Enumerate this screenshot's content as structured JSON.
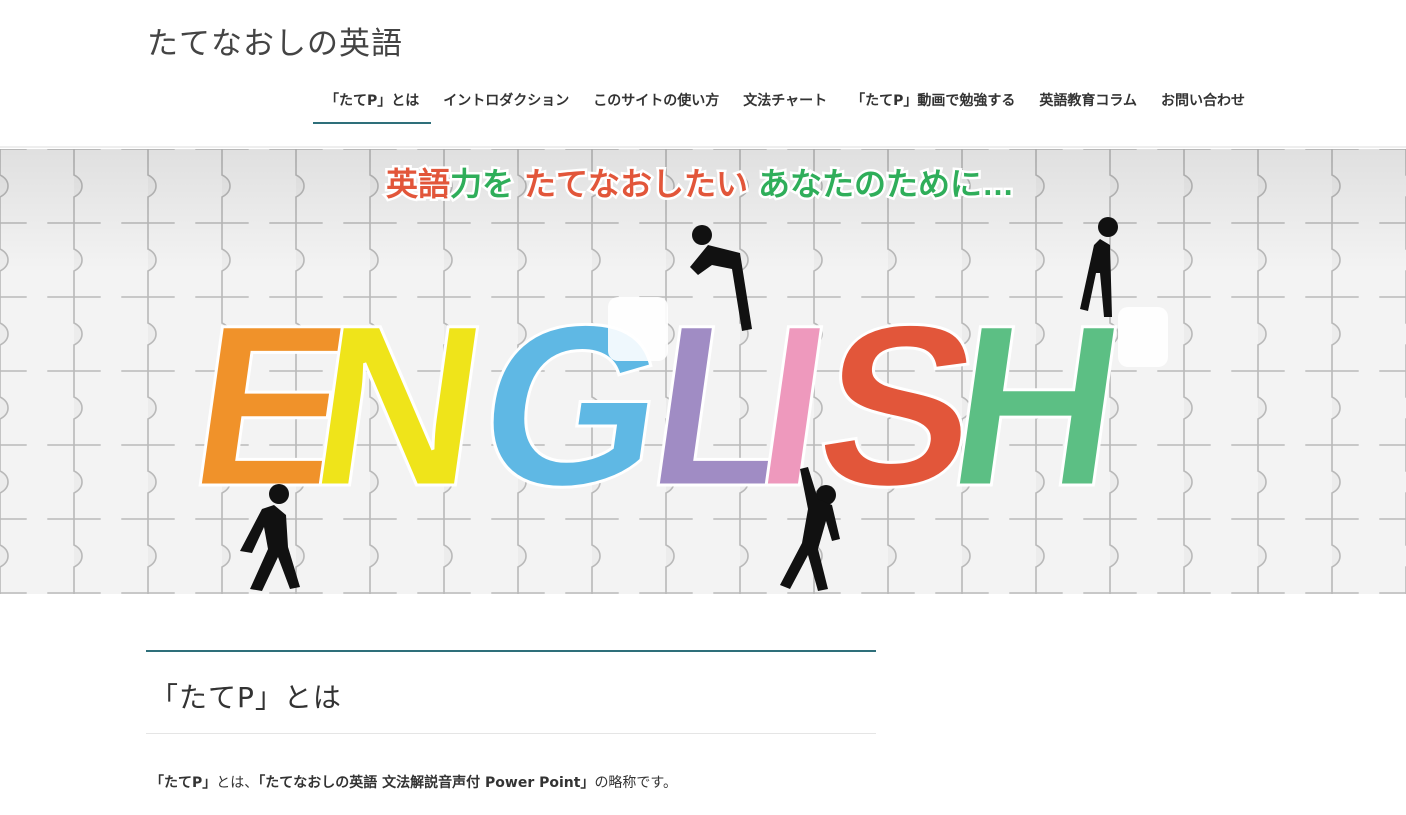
{
  "site": {
    "title": "たてなおしの英語"
  },
  "nav": {
    "items": [
      {
        "label": "「たてP」とは"
      },
      {
        "label": "イントロダクション"
      },
      {
        "label": "このサイトの使い方"
      },
      {
        "label": "文法チャート"
      },
      {
        "label": "「たてP」動画で勉強する"
      },
      {
        "label": "英語教育コラム"
      },
      {
        "label": "お問い合わせ"
      }
    ],
    "active_index": 0
  },
  "hero": {
    "tagline_parts": [
      "英語",
      "力を",
      "たてなおしたい",
      "あなたのために…"
    ],
    "tagline_colors": [
      "#e2563a",
      "#2fae5a",
      "#e2563a",
      "#2fae5a"
    ],
    "big_word_letters": [
      "E",
      "N",
      "G",
      "L",
      "I",
      "S",
      "H"
    ],
    "letter_colors": [
      "#f0922a",
      "#efe41a",
      "#5fb8e4",
      "#a08cc4",
      "#ee99bd",
      "#e2563a",
      "#5cbf84"
    ]
  },
  "main": {
    "heading": "「たてP」とは",
    "intro": {
      "term": "「たてP」",
      "mid": "とは、",
      "full_name": "「たてなおしの英語 文法解説音声付 Power Point」",
      "tail": "の略称です。"
    }
  },
  "colors": {
    "accent": "#2e6f7a"
  }
}
